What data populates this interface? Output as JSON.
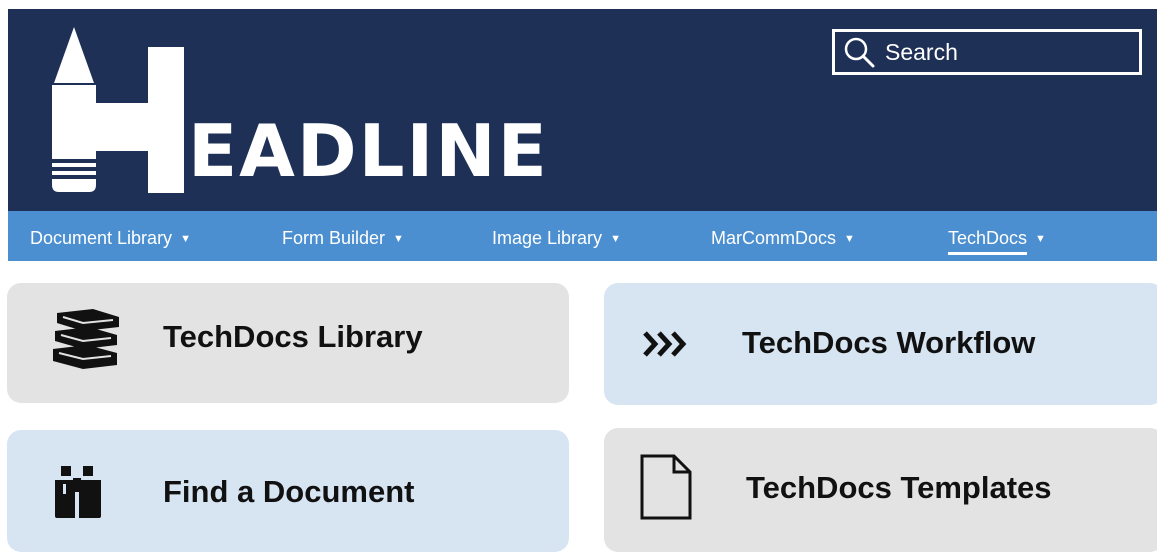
{
  "header": {
    "logo_text": "EADLINE",
    "logo_letter": "H",
    "search": {
      "placeholder": "Search",
      "icon": "search-icon"
    },
    "background_color": "#1e3055"
  },
  "nav": {
    "background_color": "#4b8fd0",
    "items": [
      {
        "label": "Document Library",
        "caret": "▼"
      },
      {
        "label": "Form Builder",
        "caret": "▼"
      },
      {
        "label": "Image Library",
        "caret": "▼"
      },
      {
        "label": "MarCommDocs",
        "caret": "▼"
      },
      {
        "label": "TechDocs",
        "caret": "▼",
        "active": true
      }
    ]
  },
  "tiles": [
    {
      "label": "TechDocs Library",
      "icon": "books-icon",
      "color": "#e3e3e3"
    },
    {
      "label": "TechDocs Workflow",
      "icon": "chevrons-right-icon",
      "color": "#d7e5f3"
    },
    {
      "label": "Find a Document",
      "icon": "binoculars-icon",
      "color": "#d7e5f3"
    },
    {
      "label": "TechDocs Templates",
      "icon": "document-icon",
      "color": "#e3e3e3"
    }
  ]
}
